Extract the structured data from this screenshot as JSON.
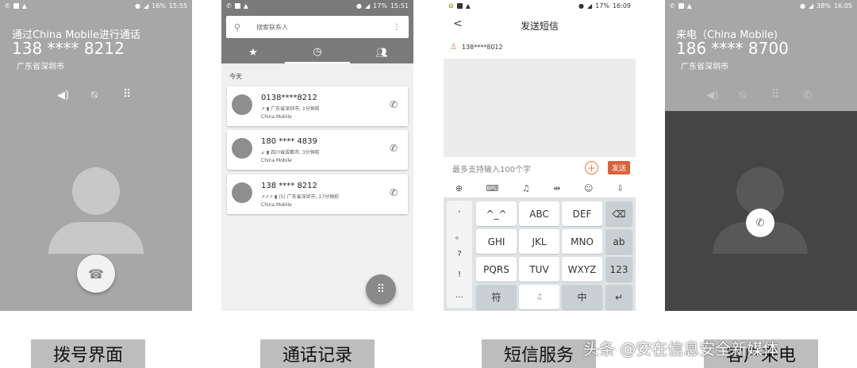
{
  "screen1": {
    "status_time": "15:55",
    "battery": "16%",
    "calling_title": "通过China Mobile进行通话",
    "number": "138 **** 8212",
    "location": "广东省深圳市"
  },
  "screen2": {
    "status_time": "15:51",
    "battery": "17%",
    "search_placeholder": "搜索联系人",
    "section_today": "今天",
    "calls": [
      {
        "number": "0138****8212",
        "detail": "广东省深圳市, 1分钟前",
        "carrier": "China Mobile"
      },
      {
        "number": "180 **** 4839",
        "detail": "四川省成都市, 3分钟前",
        "carrier": "China Mobile"
      },
      {
        "number": "138 **** 8212",
        "detail": "(5) 广东省深圳市, 17分钟前",
        "carrier": "China Mobile"
      }
    ]
  },
  "screen3": {
    "status_time": "16:09",
    "battery": "17%",
    "title": "发送短信",
    "recipient": "138****8012",
    "input_placeholder": "最多支持输入100个字",
    "send_label": "发送",
    "left_keys": [
      ",",
      "。",
      "?",
      "!",
      "..."
    ],
    "keys_row1": [
      "^_^",
      "ABC",
      "DEF"
    ],
    "keys_row2": [
      "GHI",
      "JKL",
      "MNO"
    ],
    "keys_row3": [
      "PQRS",
      "TUV",
      "WXYZ"
    ],
    "key_sym": "符",
    "key_lang": "中",
    "key_ab": "ab",
    "key_123": "123"
  },
  "screen4": {
    "status_time": "16:05",
    "battery": "38%",
    "incoming_title": "来电（China Mobile)",
    "number": "186 **** 8700",
    "location": "广东省深圳市"
  },
  "labels": {
    "l1": "拨号界面",
    "l2": "通话记录",
    "l3": "短信服务",
    "l4": "客户来电",
    "watermark": "头条 @安在信息安全新媒体"
  }
}
